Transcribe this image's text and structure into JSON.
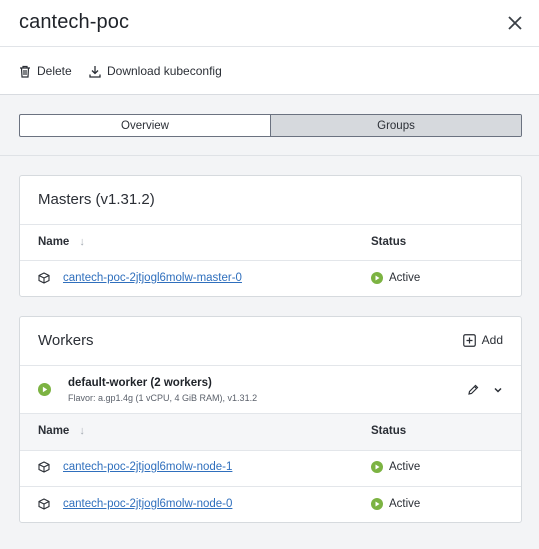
{
  "header": {
    "title": "cantech-poc"
  },
  "toolbar": {
    "delete_label": "Delete",
    "download_label": "Download kubeconfig"
  },
  "tabs": [
    {
      "label": "Overview",
      "active": false
    },
    {
      "label": "Groups",
      "active": true
    }
  ],
  "masters": {
    "title": "Masters (v1.31.2)",
    "columns": {
      "name": "Name",
      "status": "Status"
    },
    "rows": [
      {
        "name": "cantech-poc-2jtjogl6molw-master-0",
        "status": "Active"
      }
    ]
  },
  "workers": {
    "title": "Workers",
    "add_label": "Add",
    "group": {
      "name": "default-worker (2 workers)",
      "flavor": "Flavor: a.gp1.4g (1 vCPU, 4 GiB RAM), v1.31.2"
    },
    "columns": {
      "name": "Name",
      "status": "Status"
    },
    "rows": [
      {
        "name": "cantech-poc-2jtjogl6molw-node-1",
        "status": "Active"
      },
      {
        "name": "cantech-poc-2jtjogl6molw-node-0",
        "status": "Active"
      }
    ]
  },
  "colors": {
    "active_green": "#7cb342",
    "link_blue": "#2f6fbd"
  },
  "icons": [
    "close-icon",
    "trash-icon",
    "download-icon",
    "sort-arrow-icon",
    "cube-icon",
    "status-active-icon",
    "add-box-icon",
    "pencil-icon",
    "chevron-down-icon"
  ]
}
